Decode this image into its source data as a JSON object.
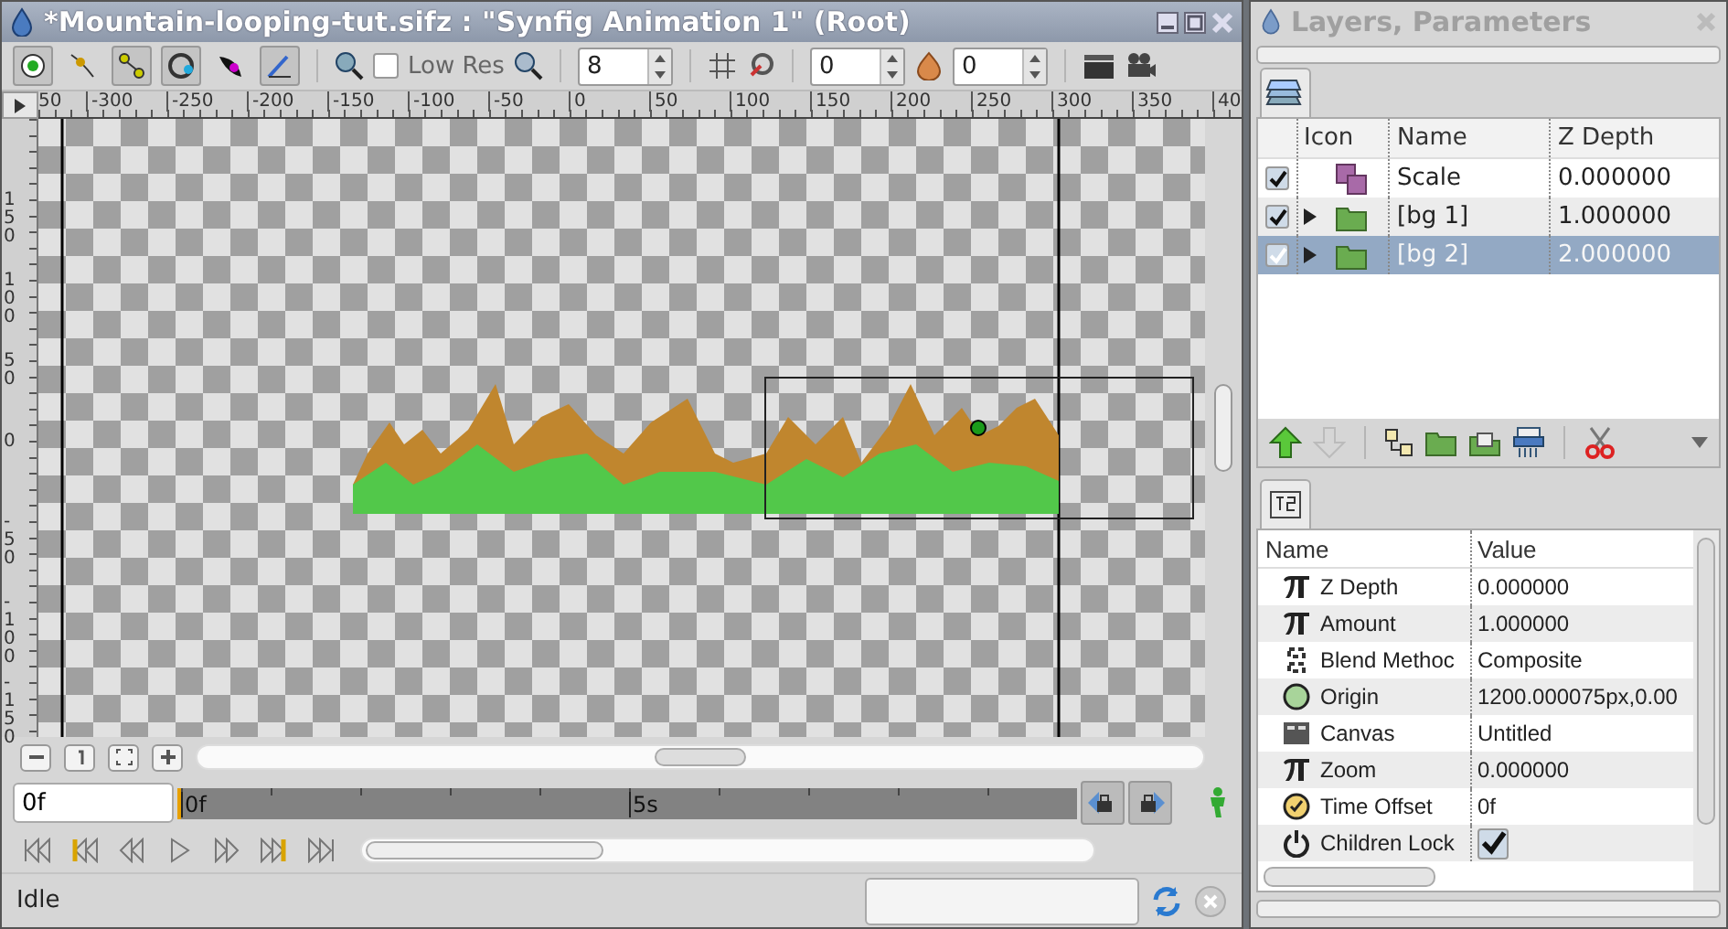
{
  "window": {
    "title": "*Mountain-looping-tut.sifz : \"Synfig Animation 1\" (Root)"
  },
  "toolbar": {
    "tools": [
      {
        "kind": "transform",
        "selected": true
      },
      {
        "kind": "smooth",
        "selected": false
      },
      {
        "kind": "scale",
        "selected": true
      },
      {
        "kind": "circle",
        "selected": true
      },
      {
        "kind": "feather",
        "selected": false
      },
      {
        "kind": "draw",
        "selected": true
      }
    ],
    "low_res": {
      "label": "Low Res",
      "checked": false
    },
    "quality": "8",
    "onion_past": "0",
    "onion_future": "0"
  },
  "ruler": {
    "h_labels": [
      "50",
      "-300",
      "-250",
      "-200",
      "-150",
      "-100",
      "-50",
      "0",
      "50",
      "100",
      "150",
      "200",
      "250",
      "300",
      "350",
      "40"
    ],
    "v_labels": [
      "150",
      "100",
      "50",
      "0",
      "-50",
      "-100",
      "-150"
    ]
  },
  "timebar": {
    "current_time": "0f",
    "labels": [
      "0f",
      "5s"
    ]
  },
  "status_bar": {
    "text": "Idle"
  },
  "panel": {
    "title": "Layers, Parameters",
    "layers": {
      "columns": [
        "Icon",
        "Name",
        "Z Depth"
      ],
      "rows": [
        {
          "kind": "scale",
          "name": "Scale",
          "z_depth": "0.000000",
          "checked": true,
          "selected": false,
          "expandable": false
        },
        {
          "kind": "group",
          "name": "[bg 1]",
          "z_depth": "1.000000",
          "checked": true,
          "selected": false,
          "expandable": true
        },
        {
          "kind": "group",
          "name": "[bg 2]",
          "z_depth": "2.000000",
          "checked": true,
          "selected": true,
          "expandable": true
        }
      ]
    },
    "params": {
      "columns": [
        "Name",
        "Value"
      ],
      "rows": [
        {
          "kind": "real",
          "name": "Z Depth",
          "value": "0.000000"
        },
        {
          "kind": "real",
          "name": "Amount",
          "value": "1.000000"
        },
        {
          "kind": "blend",
          "name": "Blend Methoc",
          "value": "Composite"
        },
        {
          "kind": "origin",
          "name": "Origin",
          "value": "1200.000075px,0.00"
        },
        {
          "kind": "canvas",
          "name": "Canvas",
          "value": "Untitled"
        },
        {
          "kind": "real",
          "name": "Zoom",
          "value": "0.000000"
        },
        {
          "kind": "time",
          "name": "Time Offset",
          "value": "0f"
        },
        {
          "kind": "lock",
          "name": "Children Lock",
          "checked": true
        }
      ]
    }
  }
}
